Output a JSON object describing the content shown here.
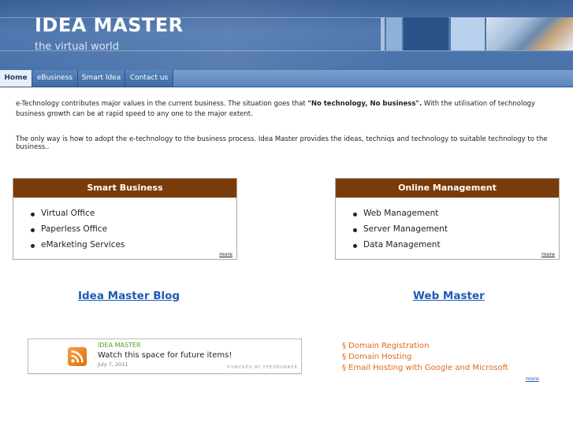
{
  "header": {
    "title": "IDEA MASTER",
    "subtitle": "the virtual world"
  },
  "nav": {
    "items": [
      "Home",
      "eBusiness",
      "Smart Idea",
      "Contact us"
    ],
    "active": "Home"
  },
  "intro": {
    "p1_a": "e-Technology  contributes major values in the current business. The situation goes that ",
    "p1_b": "\"No technology, No business\".",
    "p1_c": " With the utilisation of technology business growth can be at rapid speed to any one to the major extent.",
    "p2": "The only way is how to adopt the e-technology to the business process. Idea Master provides the ideas, techniqs and technology to suitable technology to the business.."
  },
  "boxes": [
    {
      "title": "Smart Business",
      "items": [
        "Virtual Office",
        "Paperless Office",
        "eMarketing Services"
      ],
      "more": "more"
    },
    {
      "title": "Online Management",
      "items": [
        "Web Management",
        "Server Management",
        "Data Management"
      ],
      "more": "more"
    }
  ],
  "blog": {
    "title": "Idea Master Blog",
    "feed": {
      "name": "IDEA MASTER",
      "item": "Watch this space for future items!",
      "date": "July 7, 2011",
      "powered": "POWERED BY FEEDBURNER"
    }
  },
  "webmaster": {
    "title": "Web Master",
    "items": [
      "§ Domain Registration",
      "§ Domain Hosting",
      "§ Email Hosting with Google and Microsoft"
    ],
    "more": "more"
  },
  "colors": {
    "header_bg": "#4a72aa",
    "box_head": "#7a3b0a",
    "link": "#1d5bb5",
    "accent": "#e06a1a"
  }
}
